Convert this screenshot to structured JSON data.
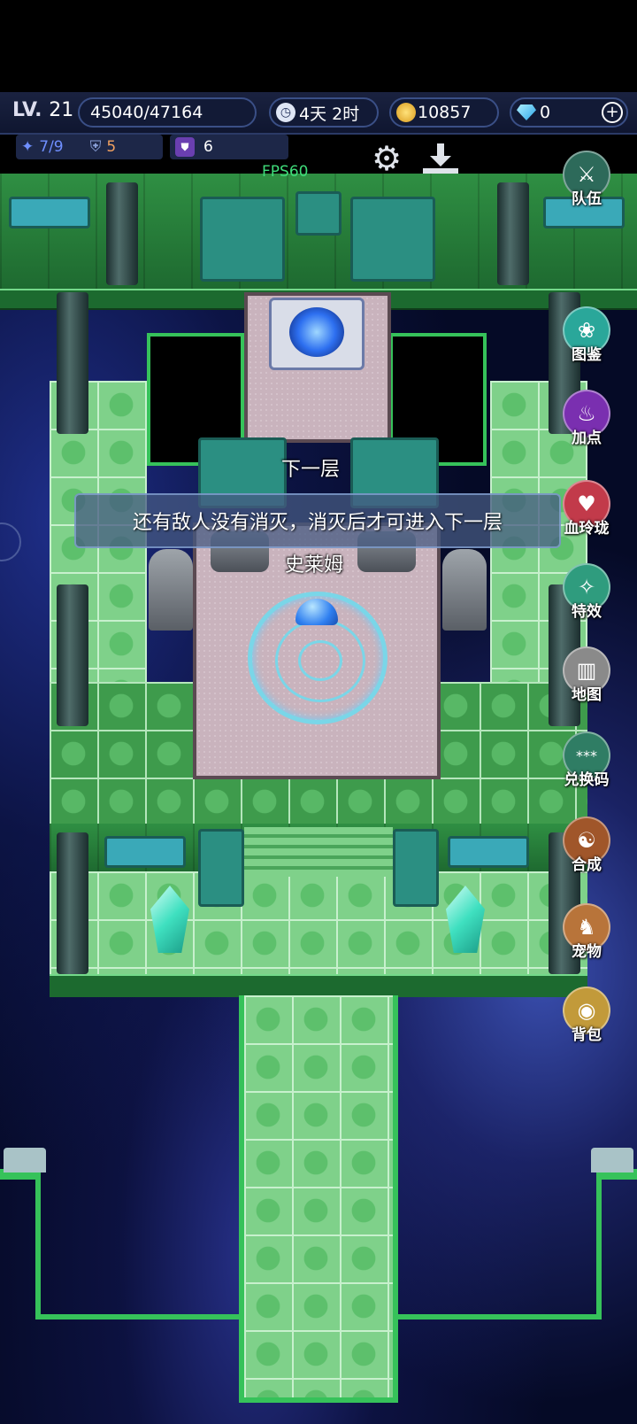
{
  "hud": {
    "level_prefix": "LV.",
    "level": "21",
    "hp": "45040/47164",
    "time": "4天 2时",
    "gold": "10857",
    "gems": "0",
    "stat_a": "7/9",
    "stat_b": "5",
    "stat_c": "6",
    "fps": "FPS60"
  },
  "side_menu": [
    {
      "label": "队伍",
      "icon": "team-icon",
      "color": "#2d6a5a"
    },
    {
      "label": "图鉴",
      "icon": "paw-icon",
      "color": "#2aa79a"
    },
    {
      "label": "加点",
      "icon": "flame-icon",
      "color": "#7a2fb0"
    },
    {
      "label": "血玲珑",
      "icon": "heart-icon",
      "color": "#c23a4a"
    },
    {
      "label": "特效",
      "icon": "wand-icon",
      "color": "#2f9c7e"
    },
    {
      "label": "地图",
      "icon": "map-icon",
      "color": "#8a8a8a"
    },
    {
      "label": "兑换码",
      "icon": "code-icon",
      "color": "#2f7d64"
    },
    {
      "label": "合成",
      "icon": "yinyang-icon",
      "color": "#a0562a"
    },
    {
      "label": "宠物",
      "icon": "pet-icon",
      "color": "#b8743a"
    },
    {
      "label": "背包",
      "icon": "bag-icon",
      "color": "#c29a3a"
    }
  ],
  "map": {
    "stairs_label": "下一层",
    "monster_label": "史莱姆"
  },
  "toast": {
    "message": "还有敌人没有消灭，消灭后才可进入下一层"
  },
  "colors": {
    "accent_green": "#36c25a",
    "hud_bg": "#121a36"
  }
}
